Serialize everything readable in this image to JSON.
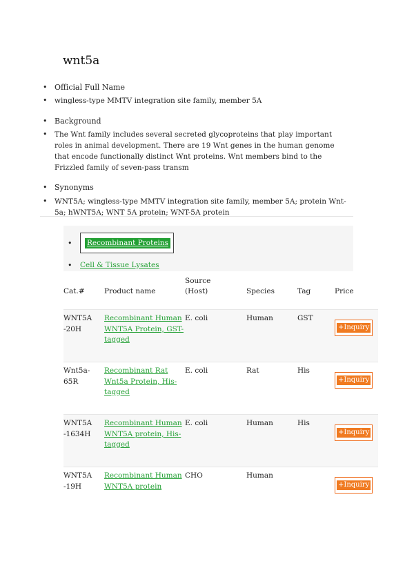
{
  "title": "wnt5a",
  "sections": [
    {
      "heading": "Official Full Name",
      "body": "wingless-type MMTV integration site family, member 5A"
    },
    {
      "heading": "Background",
      "body": "The Wnt family includes several secreted glycoproteins that play important roles in animal development. There are 19 Wnt genes in the human genome that encode functionally distinct Wnt proteins. Wnt members bind to the Frizzled family of seven-pass transm"
    },
    {
      "heading": "Synonyms",
      "body": "WNT5A; wingless-type MMTV integration site family, member 5A; protein Wnt-5a; hWNT5A; WNT 5A protein; WNT-5A protein"
    }
  ],
  "tabs": [
    {
      "label": "Recombinant Proteins",
      "active": true
    },
    {
      "label": "Cell & Tissue Lysates",
      "active": false
    }
  ],
  "table": {
    "headers": [
      "Cat.#",
      "Product name",
      "Source (Host)",
      "Species",
      "Tag",
      "Price"
    ],
    "rows": [
      {
        "cat": "WNT5A-20H",
        "name": "Recombinant Human WNT5A Protein, GST-tagged",
        "source": "E. coli",
        "species": "Human",
        "tag": "GST",
        "price": "+Inquiry"
      },
      {
        "cat": "Wnt5a-65R",
        "name": "Recombinant Rat Wnt5a Protein, His-tagged",
        "source": "E. coli",
        "species": "Rat",
        "tag": "His",
        "price": "+Inquiry"
      },
      {
        "cat": "WNT5A-1634H",
        "name": "Recombinant Human WNT5A protein, His-tagged",
        "source": "E. coli",
        "species": "Human",
        "tag": "His",
        "price": "+Inquiry"
      },
      {
        "cat": "WNT5A-19H",
        "name": "Recombinant Human WNT5A protein",
        "source": "CHO",
        "species": "Human",
        "tag": "",
        "price": "+Inquiry"
      }
    ]
  },
  "colors": {
    "link": "#23a034",
    "inquiry": "#f07a20"
  }
}
